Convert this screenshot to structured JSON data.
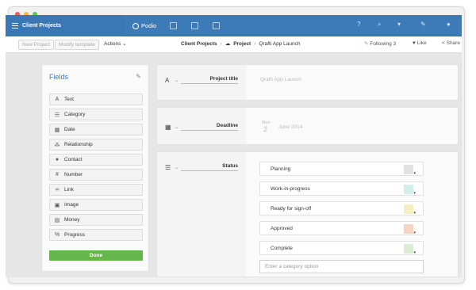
{
  "window": {
    "dots": [
      "#f05a4f",
      "#f6bd2f",
      "#5fc93f"
    ]
  },
  "topbar": {
    "title": "Client Projects",
    "brand": "Podio"
  },
  "toolbar": {
    "new_project": "New Project",
    "modify_template": "Modify template",
    "actions": "Actions",
    "breadcrumb": [
      "Client Projects",
      "Project",
      "Qrafti App Launch"
    ],
    "following_label": "Following",
    "following_count": "3",
    "like": "Like",
    "share": "Share"
  },
  "fields_panel": {
    "title": "Fields",
    "items": [
      {
        "icon": "A",
        "icon_name": "text-icon",
        "label": "Text"
      },
      {
        "icon": "☰",
        "icon_name": "category-icon",
        "label": "Category"
      },
      {
        "icon": "▦",
        "icon_name": "calendar-icon",
        "label": "Date"
      },
      {
        "icon": "⁂",
        "icon_name": "relationship-icon",
        "label": "Relationship"
      },
      {
        "icon": "●",
        "icon_name": "contact-icon",
        "label": "Contact"
      },
      {
        "icon": "#",
        "icon_name": "number-icon",
        "label": "Number"
      },
      {
        "icon": "∞",
        "icon_name": "link-icon",
        "label": "Link"
      },
      {
        "icon": "▣",
        "icon_name": "image-icon",
        "label": "Image"
      },
      {
        "icon": "▤",
        "icon_name": "money-icon",
        "label": "Money"
      },
      {
        "icon": "%",
        "icon_name": "progress-icon",
        "label": "Progress"
      }
    ],
    "done": "Done"
  },
  "form": {
    "project_title": {
      "label": "Project title",
      "placeholder": "Qrafti App Launch"
    },
    "deadline": {
      "label": "Deadline",
      "month": "Mon",
      "day": "2",
      "date_text": "June 2014"
    },
    "status": {
      "label": "Status",
      "options": [
        {
          "label": "Planning",
          "color": "#e2e2e2"
        },
        {
          "label": "Work-in-progress",
          "color": "#d3efe9"
        },
        {
          "label": "Ready for sign-off",
          "color": "#f8efc0"
        },
        {
          "label": "Approved",
          "color": "#f7d3c2"
        },
        {
          "label": "Complete",
          "color": "#dcebd3"
        }
      ],
      "new_option_placeholder": "Enter a category option"
    }
  }
}
